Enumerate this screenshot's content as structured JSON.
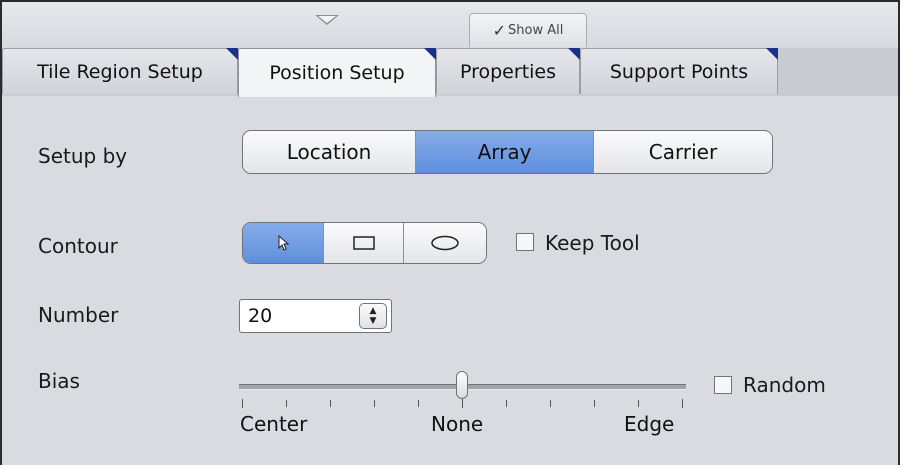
{
  "top_strip": {
    "collapse_icon": "chevron-down-triangle",
    "show_all_label": "Show All",
    "show_all_check_icon": "checkmark"
  },
  "tabs": [
    {
      "label": "Tile Region Setup",
      "active": false
    },
    {
      "label": "Position Setup",
      "active": true
    },
    {
      "label": "Properties",
      "active": false
    },
    {
      "label": "Support Points",
      "active": false
    }
  ],
  "setup_by": {
    "label": "Setup by",
    "options": [
      "Location",
      "Array",
      "Carrier"
    ],
    "selected": "Array"
  },
  "contour": {
    "label": "Contour",
    "tools": [
      {
        "icon": "cursor-arrow-icon",
        "selected": true
      },
      {
        "icon": "rectangle-icon",
        "selected": false
      },
      {
        "icon": "ellipse-icon",
        "selected": false
      }
    ],
    "keep_tool_label": "Keep Tool",
    "keep_tool_checked": false
  },
  "number": {
    "label": "Number",
    "value": "20"
  },
  "bias": {
    "label": "Bias",
    "slider_value": 0.5,
    "tick_labels": [
      "Center",
      "None",
      "Edge"
    ],
    "random_label": "Random",
    "random_checked": false
  },
  "colors": {
    "selected_segment": "#6f9be2",
    "tab_corner": "#1c2f8a",
    "panel_bg": "#d9dbe0"
  }
}
